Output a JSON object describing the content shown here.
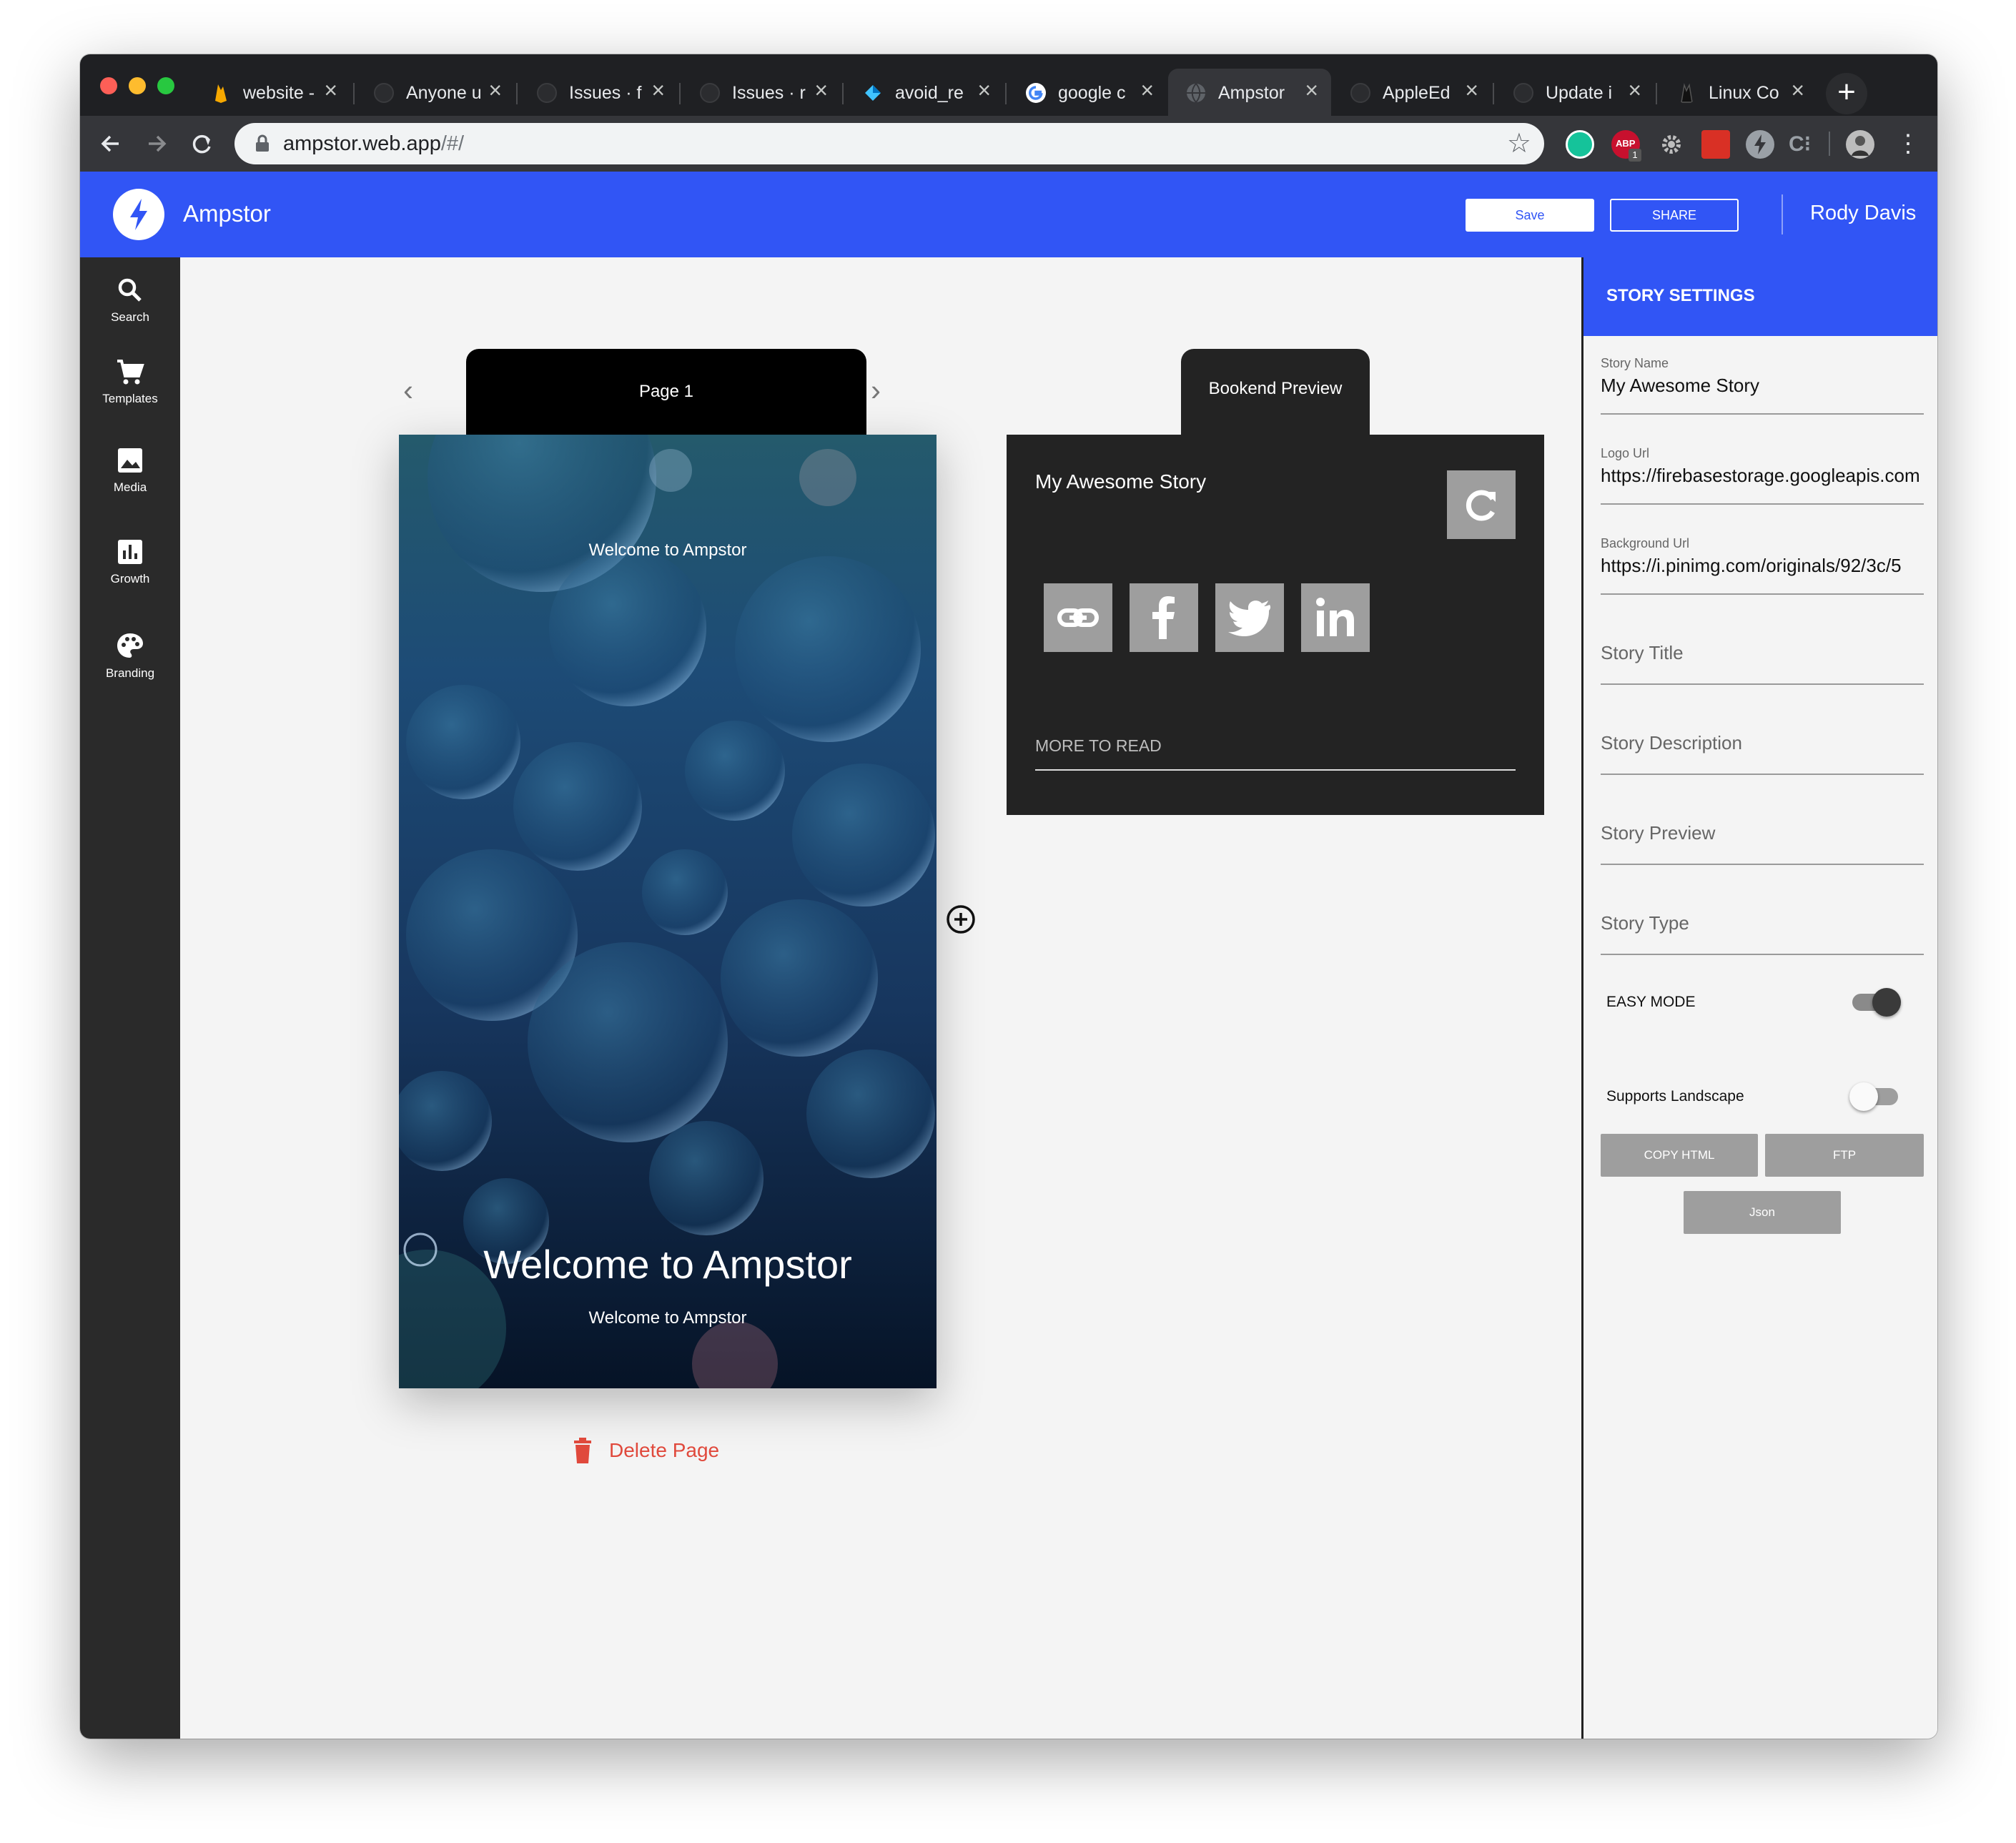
{
  "browser": {
    "tabs": [
      {
        "title": "website -",
        "favicon": "firebase-icon",
        "color": "#f6a800"
      },
      {
        "title": "Anyone u",
        "favicon": "github-icon",
        "color": "#333333"
      },
      {
        "title": "Issues · f",
        "favicon": "github-icon",
        "color": "#333333"
      },
      {
        "title": "Issues · r",
        "favicon": "github-icon",
        "color": "#333333"
      },
      {
        "title": "avoid_re",
        "favicon": "dart-icon",
        "color": "#40c4ff"
      },
      {
        "title": "google c",
        "favicon": "google-icon",
        "color": "#ffffff"
      },
      {
        "title": "Ampstor",
        "favicon": "globe-icon",
        "color": "#5f6368",
        "active": true
      },
      {
        "title": "AppleEd",
        "favicon": "github-icon",
        "color": "#333333"
      },
      {
        "title": "Update i",
        "favicon": "github-icon",
        "color": "#333333"
      },
      {
        "title": "Linux Co",
        "favicon": "linux-icon",
        "color": "#333333"
      }
    ],
    "url_host": "ampstor.web.app",
    "url_path": "/#/",
    "abp_badge": "1"
  },
  "app": {
    "title": "Ampstor",
    "save_label": "Save",
    "share_label": "SHARE",
    "user_name": "Rody Davis",
    "accent": "#3155f5"
  },
  "sidebar": {
    "items": [
      {
        "label": "Search",
        "icon": "search-icon"
      },
      {
        "label": "Templates",
        "icon": "cart-icon"
      },
      {
        "label": "Media",
        "icon": "image-icon"
      },
      {
        "label": "Growth",
        "icon": "chart-icon"
      },
      {
        "label": "Branding",
        "icon": "palette-icon"
      }
    ],
    "settings_icon": "gear-icon"
  },
  "editor": {
    "page_tab": "Page 1",
    "story_top_text": "Welcome to Ampstor",
    "story_heading": "Welcome to Ampstor",
    "story_subtext": "Welcome to Ampstor",
    "delete_label": "Delete Page"
  },
  "bookend": {
    "tab_label": "Bookend Preview",
    "title": "My Awesome Story",
    "more_label": "MORE TO READ",
    "share_icons": [
      "link-icon",
      "facebook-icon",
      "twitter-icon",
      "linkedin-icon"
    ]
  },
  "settings": {
    "header": "STORY SETTINGS",
    "story_name_label": "Story Name",
    "story_name_value": "My Awesome Story",
    "logo_url_label": "Logo Url",
    "logo_url_value": "https://firebasestorage.googleapis.com",
    "background_url_label": "Background Url",
    "background_url_value": "https://i.pinimg.com/originals/92/3c/5",
    "story_title_ph": "Story Title",
    "story_description_ph": "Story Description",
    "story_preview_ph": "Story Preview",
    "story_type_ph": "Story Type",
    "easy_mode_label": "EASY MODE",
    "easy_mode_on": true,
    "landscape_label": "Supports Landscape",
    "landscape_on": false,
    "copy_html_label": "COPY HTML",
    "ftp_label": "FTP",
    "json_label": "Json"
  }
}
